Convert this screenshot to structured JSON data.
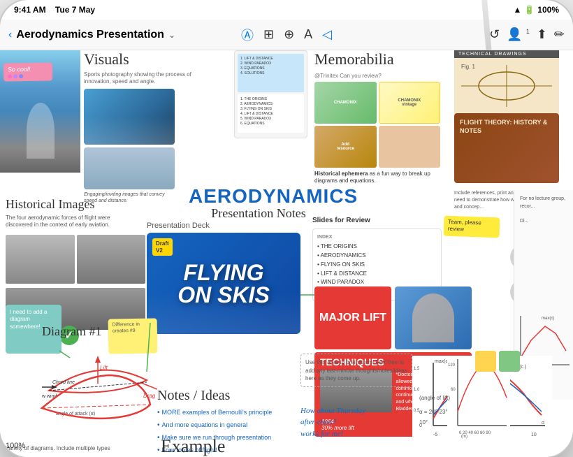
{
  "device": {
    "status_bar": {
      "time": "9:41 AM",
      "date": "Tue 7 May",
      "battery": "100%",
      "wifi": true
    }
  },
  "toolbar": {
    "back_label": "‹",
    "title": "Aerodynamics Presentation",
    "chevron": "⌄",
    "undo_icon": "↺",
    "people_icon": "👤",
    "share_icon": "⬆",
    "edit_icon": "✏",
    "view_icon1": "Ⓐ",
    "view_icon2": "⊞",
    "view_icon3": "⊕",
    "view_icon4": "A",
    "view_icon5": "◁",
    "people_count": "1"
  },
  "canvas": {
    "visuals": {
      "title": "Visuals",
      "description": "Sports photography showing the process of innovation, speed and angle.",
      "caption": "Engaging/inviting images that convey speed and distance."
    },
    "sticky_cool": {
      "text": "So cool!",
      "dots": [
        "#ff6ec7",
        "#c084fc",
        "#818cf8"
      ]
    },
    "memorabilia": {
      "title": "Memorabilia",
      "caption_bold": "Historical ephemera",
      "caption": " as a fun way to break up diagrams and equations."
    },
    "technical_drawings": {
      "header": "Technical Drawings"
    },
    "flight_theory": {
      "title": "FLIGHT THEORY: HISTORY & NOTES"
    },
    "main_title": {
      "line1": "AERODYNAMICS",
      "line2": "Presentation Notes"
    },
    "historical_images": {
      "title": "Historical Images",
      "description": "The four aerodynamic forces of flight were discovered in the context of early aviation."
    },
    "presentation_deck": {
      "label": "Presentation Deck",
      "draft_badge": "Draft\nV2",
      "slide_text": "FLYING\nON SKIS"
    },
    "slides_review": {
      "title": "Slides for Review",
      "index_label": "INDEX",
      "items": [
        "THE ORIGINS",
        "AERODYNAMICS",
        "FLYING ON SKIS",
        "LIFT & DISTANCE",
        "WIND PARADOX",
        "EQUATIONS"
      ]
    },
    "team_note": {
      "text": "Team, please review"
    },
    "major_lift": {
      "text": "MAJOR LIFT"
    },
    "techniques": {
      "title": "TECHNIQUES"
    },
    "notes_ideas": {
      "title": "Notes / Ideas",
      "items": [
        "MORE examples of Bernoulli's principle",
        "And more equations in general",
        "Make sure we run through presentation",
        "Four forces of flight!"
      ]
    },
    "brainstorm": {
      "text": "Use this area to brainstorm! Feel free to add any last-minute thoughts/notes/ideas here as they come up."
    },
    "handwritten_blue": {
      "line1": "How about Thursday",
      "line2": "after class?",
      "line3": "works for me!"
    },
    "diagram": {
      "title": "Diagram #1",
      "label1": "Chord line",
      "label2": "Lift",
      "label3": "Drag",
      "label4": "w wind",
      "label5": "angle of attack (α)"
    },
    "zoom": {
      "level": "100%"
    },
    "diagram_caption": {
      "text": "Variety of diagrams. Include multiple types"
    },
    "example_label": "Example",
    "check_done": "✓",
    "sticky_teal": {
      "text": "I need to add a diagram somewhere!"
    },
    "sticky_yellow": {
      "text": "Difference in creates #9"
    }
  }
}
